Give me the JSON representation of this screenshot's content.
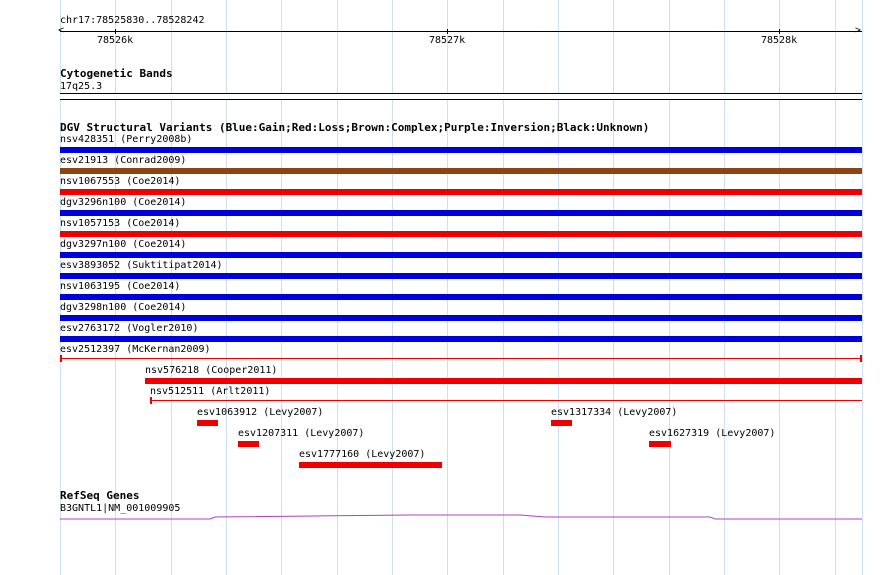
{
  "ruler": {
    "locus": "chr17:78525830..78528242",
    "ticks": [
      "78526k",
      "78527k",
      "78528k"
    ]
  },
  "cytoband": {
    "title": "Cytogenetic Bands",
    "band": "17q25.3"
  },
  "dgv": {
    "title": "DGV Structural Variants (Blue:Gain;Red:Loss;Brown:Complex;Purple:Inversion;Black:Unknown)",
    "colors": {
      "gain": "#0000dd",
      "loss": "#ee0000",
      "complex": "#8b4513"
    },
    "variants": [
      {
        "label": "nsv428351 (Perry2008b)",
        "type": "gain"
      },
      {
        "label": "esv21913 (Conrad2009)",
        "type": "complex"
      },
      {
        "label": "nsv1067553 (Coe2014)",
        "type": "loss"
      },
      {
        "label": "dgv3296n100 (Coe2014)",
        "type": "gain"
      },
      {
        "label": "nsv1057153 (Coe2014)",
        "type": "loss"
      },
      {
        "label": "dgv3297n100 (Coe2014)",
        "type": "gain"
      },
      {
        "label": "esv3893052 (Suktitipat2014)",
        "type": "gain"
      },
      {
        "label": "nsv1063195 (Coe2014)",
        "type": "gain"
      },
      {
        "label": "dgv3298n100 (Coe2014)",
        "type": "gain"
      },
      {
        "label": "esv2763172 (Vogler2010)",
        "type": "gain"
      },
      {
        "label": "esv2512397 (McKernan2009)",
        "type": "loss"
      },
      {
        "label": "nsv576218 (Cooper2011)",
        "type": "loss"
      },
      {
        "label": "nsv512511 (Arlt2011)",
        "type": "loss"
      },
      {
        "label": "esv1063912 (Levy2007)",
        "type": "loss"
      },
      {
        "label": "esv1317334 (Levy2007)",
        "type": "loss"
      },
      {
        "label": "esv1207311 (Levy2007)",
        "type": "loss"
      },
      {
        "label": "esv1627319 (Levy2007)",
        "type": "loss"
      },
      {
        "label": "esv1777160 (Levy2007)",
        "type": "loss"
      }
    ]
  },
  "refseq": {
    "title": "RefSeq Genes",
    "gene": "B3GNTL1|NM_001009905",
    "color": "#b040c0"
  }
}
